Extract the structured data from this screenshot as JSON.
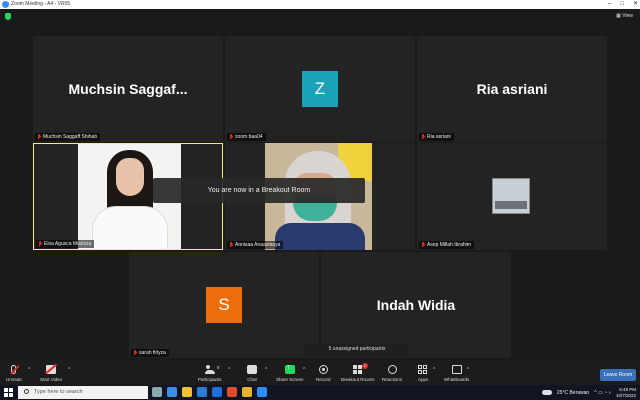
{
  "window": {
    "title": "Zoom Meeting - A4 - VR05",
    "view_label": "▦ View"
  },
  "tiles": [
    {
      "id": "muchsin",
      "big_name": "Muchsin  Saggaf...",
      "tag": "Muchsin Saggaff Shihab"
    },
    {
      "id": "zoom",
      "avatar_letter": "Z",
      "avatar_color": "#1aa3b8",
      "tag": "zoom baa04"
    },
    {
      "id": "ria",
      "big_name": "Ria asriani",
      "tag": "Ria asriani"
    },
    {
      "id": "elsa",
      "tag": "Elsa Agusca Muzizza",
      "active": true
    },
    {
      "id": "annisaa",
      "tag": "Annisaa Anaastasya"
    },
    {
      "id": "asep",
      "tag": "Asep Millah Ibrahim"
    },
    {
      "id": "sarah",
      "avatar_letter": "S",
      "avatar_color": "#ec6d0c",
      "tag": "sarah firlyza"
    },
    {
      "id": "indah",
      "big_name": "Indah Widia"
    }
  ],
  "toast": "You are now in a Breakout Room",
  "unassigned": "5 unassigned participants",
  "toolbar": {
    "unmute": "Unmute",
    "start_video": "Start Video",
    "participants": "Participants",
    "participants_count": "8",
    "chat": "Chat",
    "share_screen": "Share Screen",
    "record": "Record",
    "breakout_rooms": "Breakout Rooms",
    "breakout_badge": "2",
    "reactions": "Reactions",
    "apps": "Apps",
    "whiteboards": "Whiteboards",
    "leave_room": "Leave Room",
    "caret": "^"
  },
  "taskbar": {
    "search_placeholder": "Type here to search",
    "weather": "25°C  Berawan",
    "time": "6:48 PM",
    "date": "10/7/2022"
  },
  "colors": {
    "active_border": "#f4f46c",
    "share_green": "#23d959",
    "muted_red": "#e02828"
  }
}
